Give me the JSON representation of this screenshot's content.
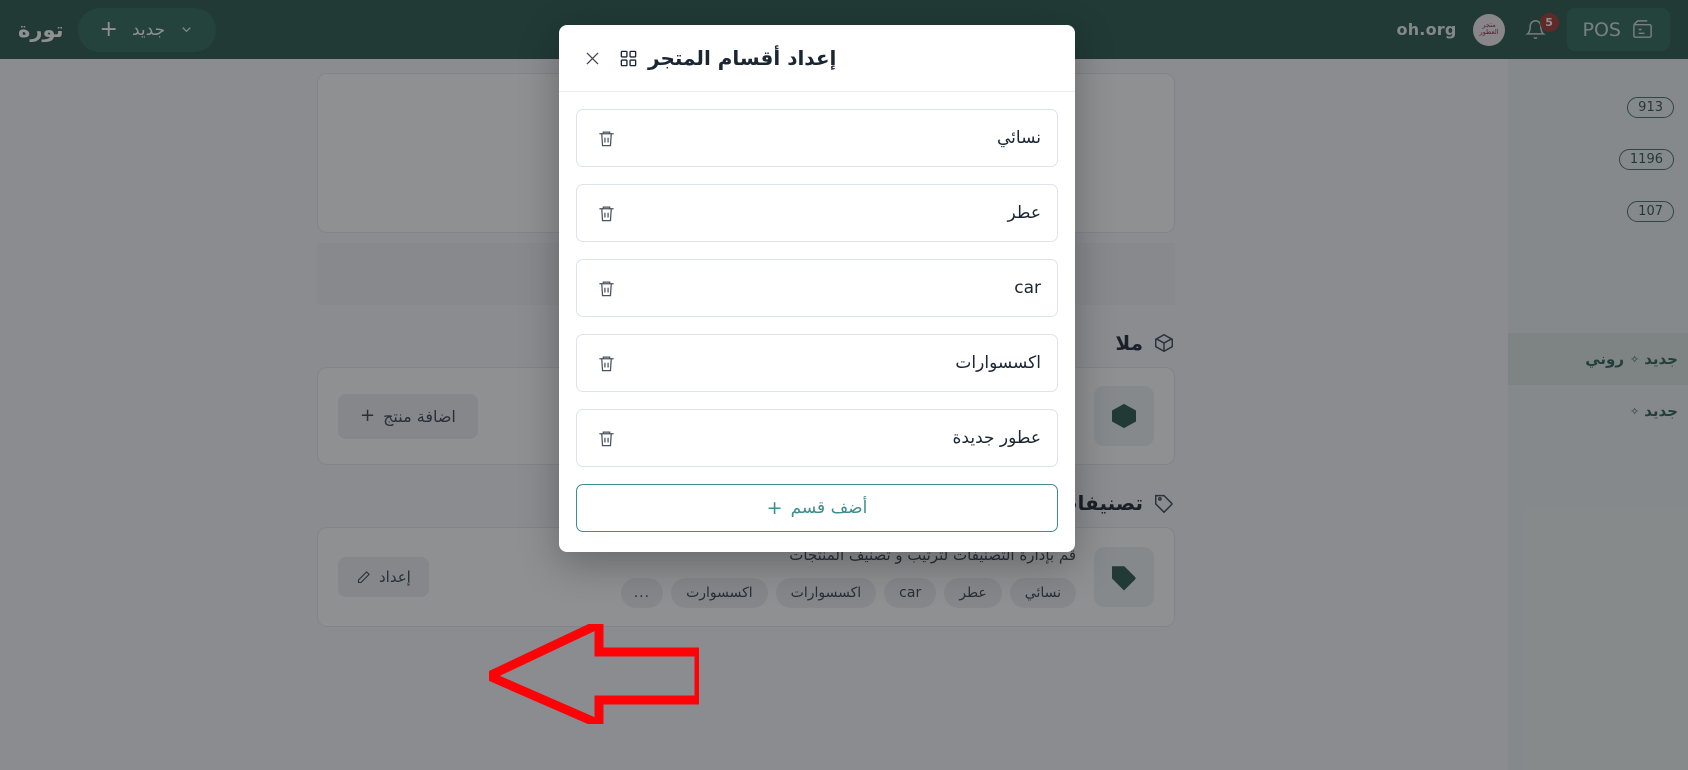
{
  "navbar": {
    "domain": "oh.org",
    "avatar_text": "متجر العطور",
    "notifications_count": "5",
    "pos_label": "POS",
    "brand": "تورة",
    "new_label": "جديد",
    "new_plus": "+"
  },
  "right_rail": {
    "badges": [
      "913",
      "1196",
      "107"
    ],
    "links": [
      {
        "label": "جديد",
        "prefix": "روني"
      },
      {
        "label": "جديد",
        "prefix": ""
      }
    ],
    "brand_tail": "ورة"
  },
  "content": {
    "products_section": {
      "title": "ملا",
      "add_product_label": "اضافة منتج",
      "add_plus": "+"
    },
    "categories_section": {
      "title": "تصنيفات المتجر",
      "description": "قم بإدارة التصنيفات لترتيب و تصنيف المنتجات",
      "chips": [
        "نسائي",
        "عطر",
        "car",
        "اكسسوارات",
        "اكسسوارت",
        "..."
      ],
      "settings_label": "إعداد"
    }
  },
  "modal": {
    "title": "إعداد أقسام المتجر",
    "grid_icon": "grid-icon",
    "close_icon": "close-icon",
    "categories": [
      {
        "name": "نسائي",
        "delete_icon": "trash-icon"
      },
      {
        "name": "عطر",
        "delete_icon": "trash-icon"
      },
      {
        "name": "car",
        "delete_icon": "trash-icon"
      },
      {
        "name": "اكسسوارات",
        "delete_icon": "trash-icon"
      },
      {
        "name": "عطور جديدة",
        "delete_icon": "trash-icon"
      }
    ],
    "add_button": {
      "plus": "+",
      "label": "أضف قسم"
    }
  },
  "colors": {
    "navbar_green": "#2d5b4e",
    "accent_teal": "#3f8d8c",
    "badge_red": "#a33c33",
    "annotation_red": "#fb0307",
    "rail_green_text": "#2f6456"
  }
}
